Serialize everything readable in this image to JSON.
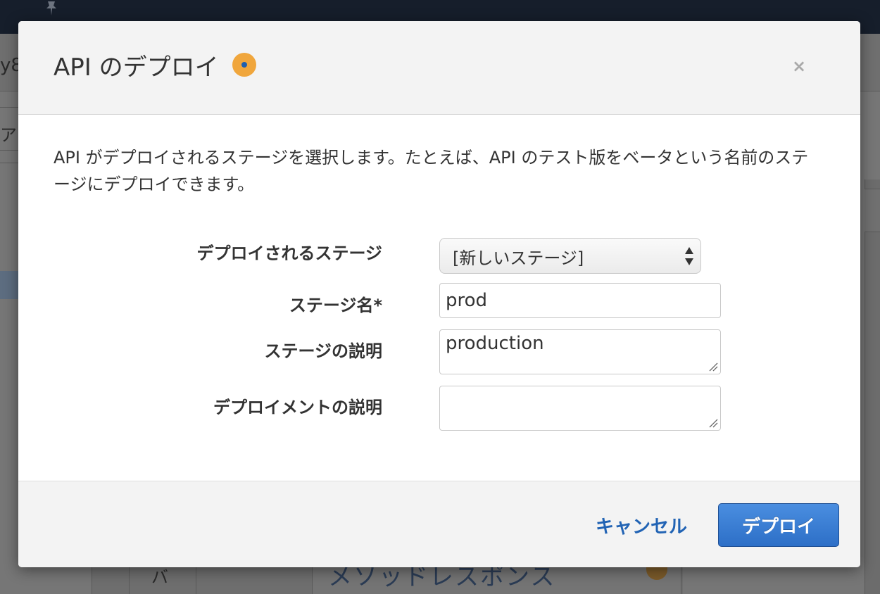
{
  "background": {
    "left_text_top": "y8",
    "left_text_mid": "アョ",
    "bottom_text": "メソッドレスポンス",
    "bottom_char": "バ"
  },
  "modal": {
    "title": "API のデプロイ",
    "close_label": "×",
    "description": "API がデプロイされるステージを選択します。たとえば、API のテスト版をベータという名前のステージにデプロイできます。",
    "fields": {
      "stage": {
        "label": "デプロイされるステージ",
        "value": "[新しいステージ]"
      },
      "stage_name": {
        "label": "ステージ名*",
        "value": "prod"
      },
      "stage_description": {
        "label": "ステージの説明",
        "value": "production"
      },
      "deployment_description": {
        "label": "デプロイメントの説明",
        "value": ""
      }
    },
    "footer": {
      "cancel_label": "キャンセル",
      "deploy_label": "デプロイ"
    }
  },
  "colors": {
    "primary_button": "#2d6fc7",
    "link": "#2163b4",
    "info_badge": "#f0a63c"
  }
}
